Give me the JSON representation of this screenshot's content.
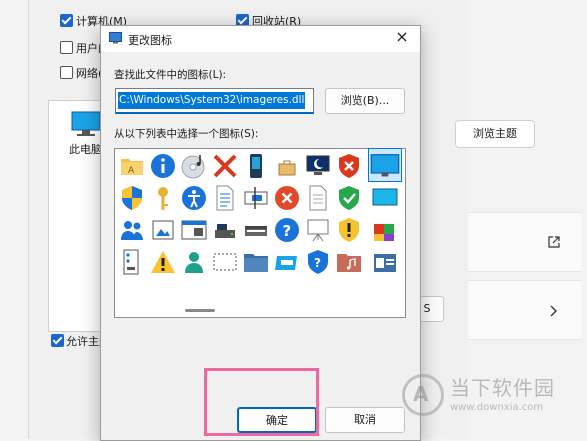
{
  "background": {
    "checkboxes": [
      {
        "label": "计算机(M)",
        "checked": true
      },
      {
        "label": "回收站(R)",
        "checked": true
      },
      {
        "label": "用户的",
        "checked": false
      },
      {
        "label": "网络(",
        "checked": false
      }
    ],
    "desktop_icon_label": "此电脑",
    "browse_theme_label": "浏览主题",
    "allow_theme_label": "允许主题",
    "small_button_label": "S"
  },
  "dialog": {
    "title": "更改图标",
    "find_label": "查找此文件中的图标(L):",
    "path_value": "C:\\Windows\\System32\\imageres.dll",
    "browse_label": "浏览(B)...",
    "select_label": "从以下列表中选择一个图标(S):",
    "ok_label": "确定",
    "cancel_label": "取消"
  },
  "icons": [
    [
      "folder-a-icon",
      "info-icon",
      "cd-audio-icon",
      "red-x-icon",
      "usb-drive-icon",
      "briefcase-icon",
      "sleep-monitor-icon",
      "shield-x-icon",
      "monitor-icon"
    ],
    [
      "windows-shield-icon",
      "key-icon",
      "accessibility-icon",
      "document-text-icon",
      "screen-text-icon",
      "error-circle-icon",
      "blank-document-icon",
      "shield-check-icon",
      "monitor-blue-icon"
    ],
    [
      "users-icon",
      "picture-frame-icon",
      "window-app-icon",
      "drive-icon",
      "scanner-icon",
      "help-icon",
      "presentation-icon",
      "warning-shield-icon",
      "software-box-icon"
    ],
    [
      "device-list-icon",
      "warning-icon",
      "user-icon",
      "crop-screen-icon",
      "folder-blue-icon",
      "screen-card-icon",
      "help-shield-icon",
      "music-folder-icon",
      "contacts-icon"
    ]
  ],
  "watermark": {
    "brand": "当下软件园",
    "url": "www.downxia.com"
  }
}
